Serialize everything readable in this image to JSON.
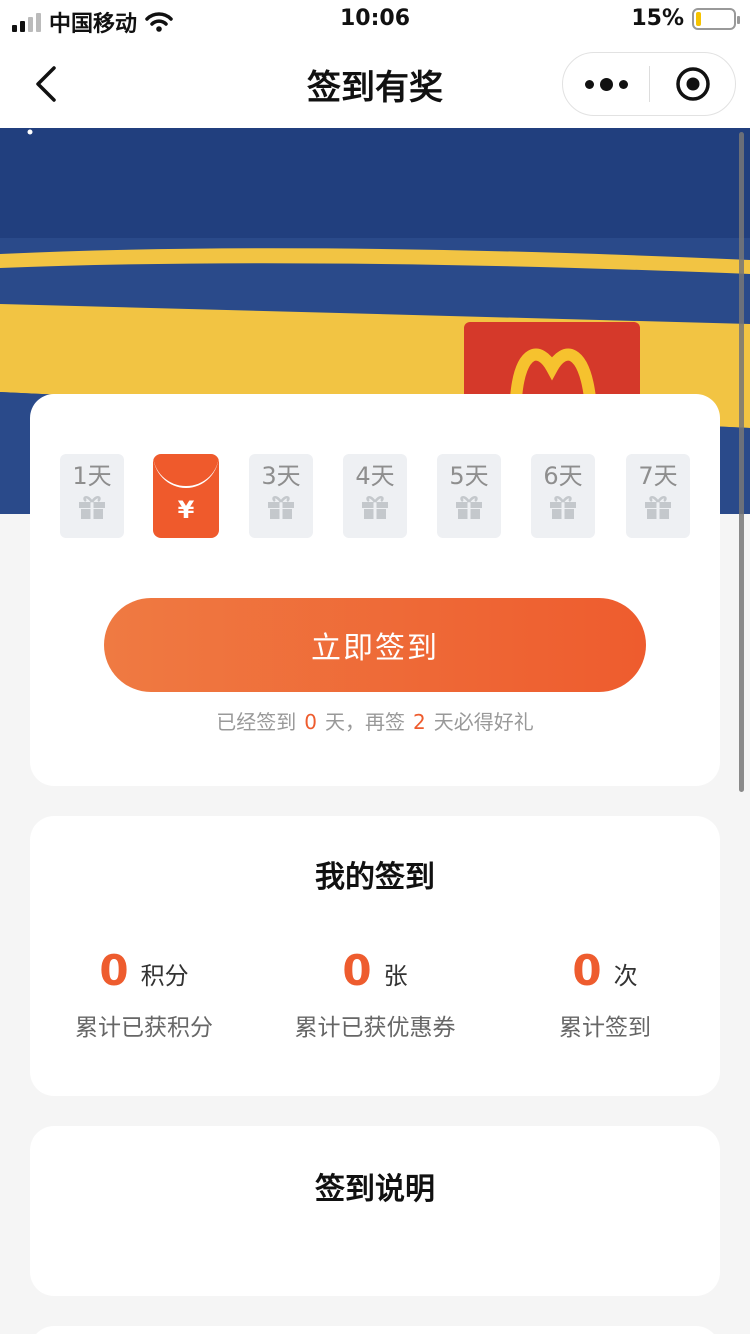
{
  "status_bar": {
    "carrier": "中国移动",
    "time": "10:06",
    "battery": "15%",
    "battery_level": 0.15
  },
  "nav": {
    "title": "签到有奖"
  },
  "checkin": {
    "days": [
      {
        "label": "1天",
        "state": "gift"
      },
      {
        "label": "",
        "state": "active"
      },
      {
        "label": "3天",
        "state": "gift"
      },
      {
        "label": "4天",
        "state": "gift"
      },
      {
        "label": "5天",
        "state": "gift"
      },
      {
        "label": "6天",
        "state": "gift"
      },
      {
        "label": "7天",
        "state": "gift"
      }
    ],
    "active_symbol": "¥",
    "button_label": "立即签到",
    "tip_prefix": "已经签到",
    "tip_days_signed": "0",
    "tip_middle": "天，再签",
    "tip_days_remaining": "2",
    "tip_suffix": "天必得好礼"
  },
  "my_checkin": {
    "title": "我的签到",
    "stats": [
      {
        "value": "0",
        "unit": "积分",
        "label": "累计已获积分"
      },
      {
        "value": "0",
        "unit": "张",
        "label": "累计已获优惠券"
      },
      {
        "value": "0",
        "unit": "次",
        "label": "累计签到"
      }
    ]
  },
  "description": {
    "title": "签到说明"
  },
  "colors": {
    "accent": "#ee5c2e",
    "banner_blue": "#2a4a8a",
    "banner_yellow": "#f2c443"
  }
}
